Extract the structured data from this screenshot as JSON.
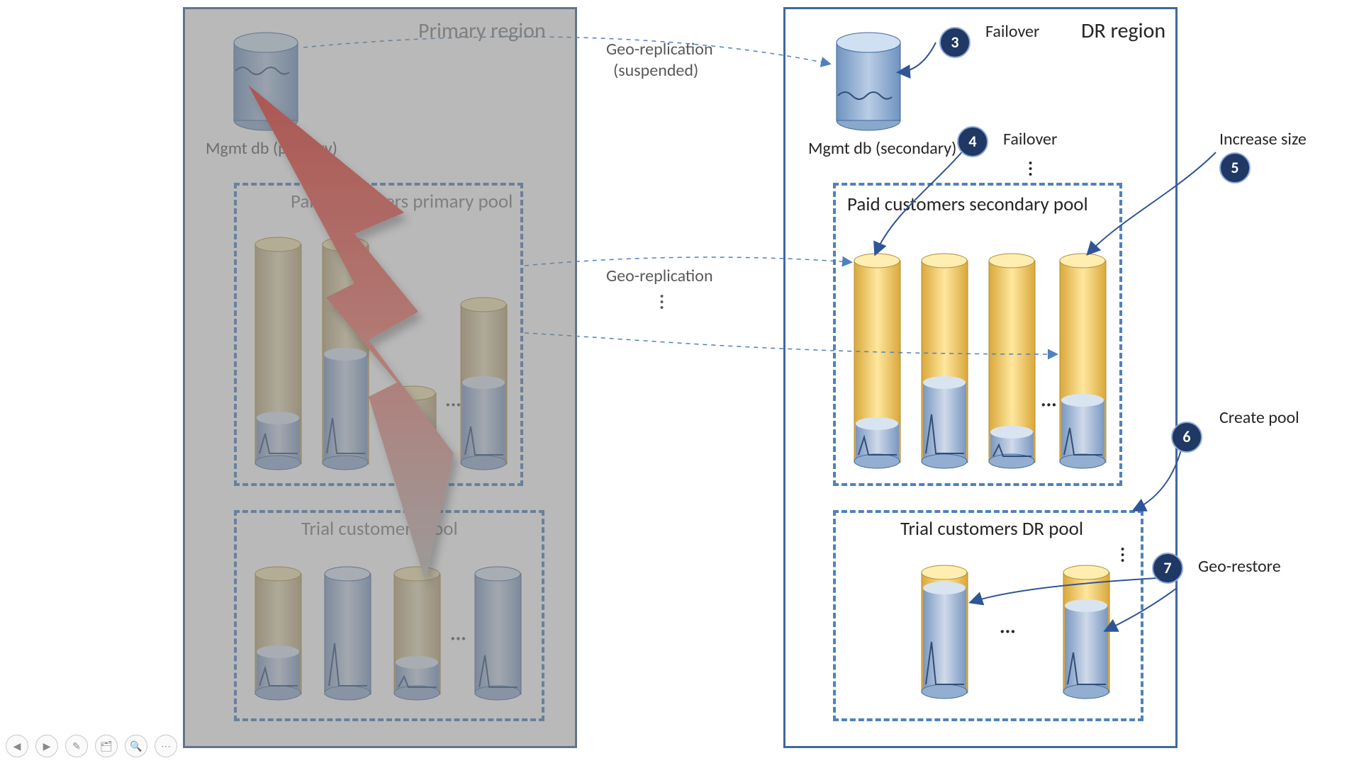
{
  "primary": {
    "title": "Primary region",
    "mgmt_db": "Mgmt db (primary)",
    "paid_pool": "Paid customers primary pool",
    "trial_pool": "Trial customers pool"
  },
  "dr": {
    "title": "DR region",
    "mgmt_db": "Mgmt db (secondary)",
    "paid_pool": "Paid customers secondary pool",
    "trial_pool": "Trial customers DR pool"
  },
  "arrows": {
    "geo_suspended_line1": "Geo-replication",
    "geo_suspended_line2": "(suspended)",
    "geo_replication": "Geo-replication",
    "failover_3": "Failover",
    "failover_4": "Failover",
    "increase_size": "Increase size",
    "create_pool": "Create pool",
    "geo_restore": "Geo-restore"
  },
  "steps": {
    "s3": "3",
    "s4": "4",
    "s5": "5",
    "s6": "6",
    "s7": "7"
  },
  "ellipsis": {
    "dots": "···"
  },
  "toolbar": {
    "prev": "◀",
    "next": "▶",
    "pen": "✎",
    "menu": "🗂",
    "zoom": "🔍",
    "more": "⋯"
  }
}
